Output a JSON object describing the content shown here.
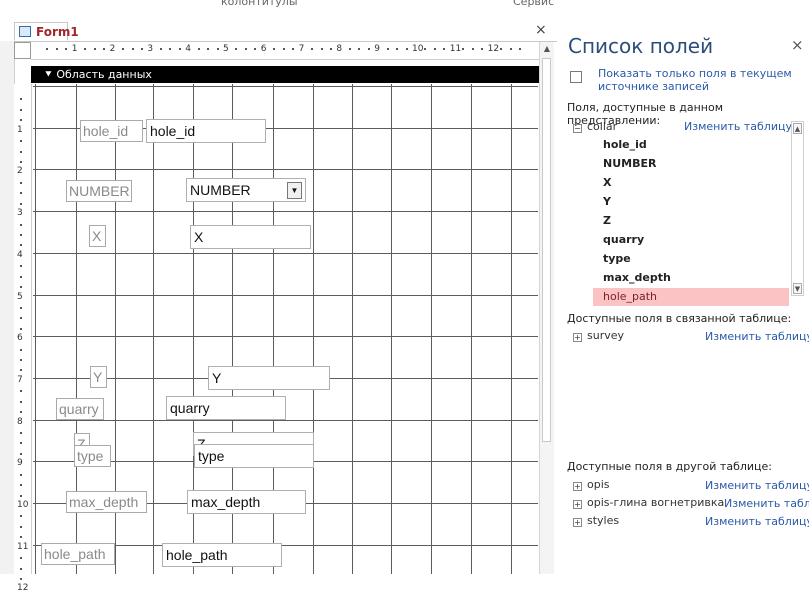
{
  "ribbon_strip": {
    "left_text": "колонтитулы",
    "right_text": "Сервис"
  },
  "form_tab": {
    "label": "Form1"
  },
  "close_glyph": "×",
  "ruler": {
    "h_numbers": [
      "1",
      "2",
      "3",
      "4",
      "5",
      "6",
      "7",
      "8",
      "9",
      "10",
      "11",
      "12"
    ],
    "v_numbers": [
      "1",
      "2",
      "3",
      "4",
      "5",
      "6",
      "7",
      "8",
      "9",
      "10",
      "11",
      "12"
    ]
  },
  "section": {
    "label": "Область данных"
  },
  "controls": [
    {
      "label": "hole_id",
      "field": "hole_id"
    },
    {
      "label": "NUMBER",
      "field": "NUMBER"
    },
    {
      "label": "X",
      "field": "X"
    },
    {
      "label": "Y",
      "field": "Y"
    },
    {
      "label": "Z",
      "field": "Z"
    },
    {
      "label": "quarry",
      "field": "quarry"
    },
    {
      "label": "type",
      "field": "type"
    },
    {
      "label": "max_depth",
      "field": "max_depth"
    },
    {
      "label": "hole_path",
      "field": "hole_path"
    }
  ],
  "field_pane": {
    "title": "Список полей",
    "close_glyph": "×",
    "show_only_link": "Показать только поля в текущем источнике записей",
    "available_heading": "Поля, доступные в данном представлении:",
    "table_name": "collar",
    "edit_link": "Изменить таблицу",
    "fields": [
      "hole_id",
      "NUMBER",
      "X",
      "Y",
      "Z",
      "quarry",
      "type",
      "max_depth",
      "hole_path"
    ],
    "selected_field": "hole_path",
    "related_heading": "Доступные поля в связанной таблице:",
    "related_tables": [
      {
        "name": "survey",
        "edit": "Изменить таблицу"
      }
    ],
    "other_heading": "Доступные поля в другой таблице:",
    "other_tables": [
      {
        "name": "opis",
        "edit": "Изменить таблицу"
      },
      {
        "name": "opis-глина вогнетривка",
        "edit": "Изменить табл"
      },
      {
        "name": "styles",
        "edit": "Изменить таблицу"
      }
    ]
  },
  "colors": {
    "tab_text": "#a0262a",
    "pane_title": "#2b4d7a",
    "link": "#2a5aa8",
    "selected_bg": "#fbc3c4"
  },
  "icons": [
    "form-icon",
    "close-icon",
    "section-arrow-icon",
    "dropdown-arrow-icon",
    "show-only-icon",
    "expand-icon",
    "collapse-icon"
  ]
}
